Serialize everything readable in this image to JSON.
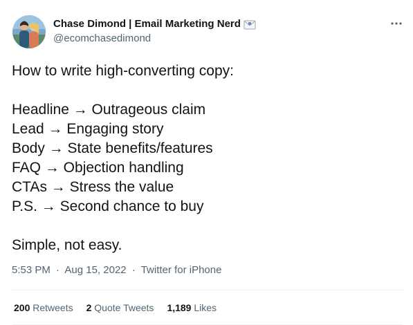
{
  "author": {
    "display_name": "Chase Dimond | Email Marketing Nerd",
    "handle": "@ecomchasedimond",
    "name_emoji_icon": "envelope-icon"
  },
  "tweet": {
    "lines": [
      "How to write high-converting copy:",
      "",
      "Headline → Outrageous claim",
      "Lead → Engaging story",
      "Body → State benefits/features",
      "FAQ → Objection handling",
      "CTAs → Stress the value",
      "P.S. → Second chance to buy",
      "",
      "Simple, not easy."
    ],
    "time": "5:53 PM",
    "date": "Aug 15, 2022",
    "separator": "·",
    "source": "Twitter for iPhone"
  },
  "stats": {
    "retweets_count": "200",
    "retweets_label": "Retweets",
    "quotes_count": "2",
    "quotes_label": "Quote Tweets",
    "likes_count": "1,189",
    "likes_label": "Likes"
  },
  "colors": {
    "text_primary": "#0f1419",
    "text_secondary": "#536471",
    "divider": "#eff3f4"
  }
}
